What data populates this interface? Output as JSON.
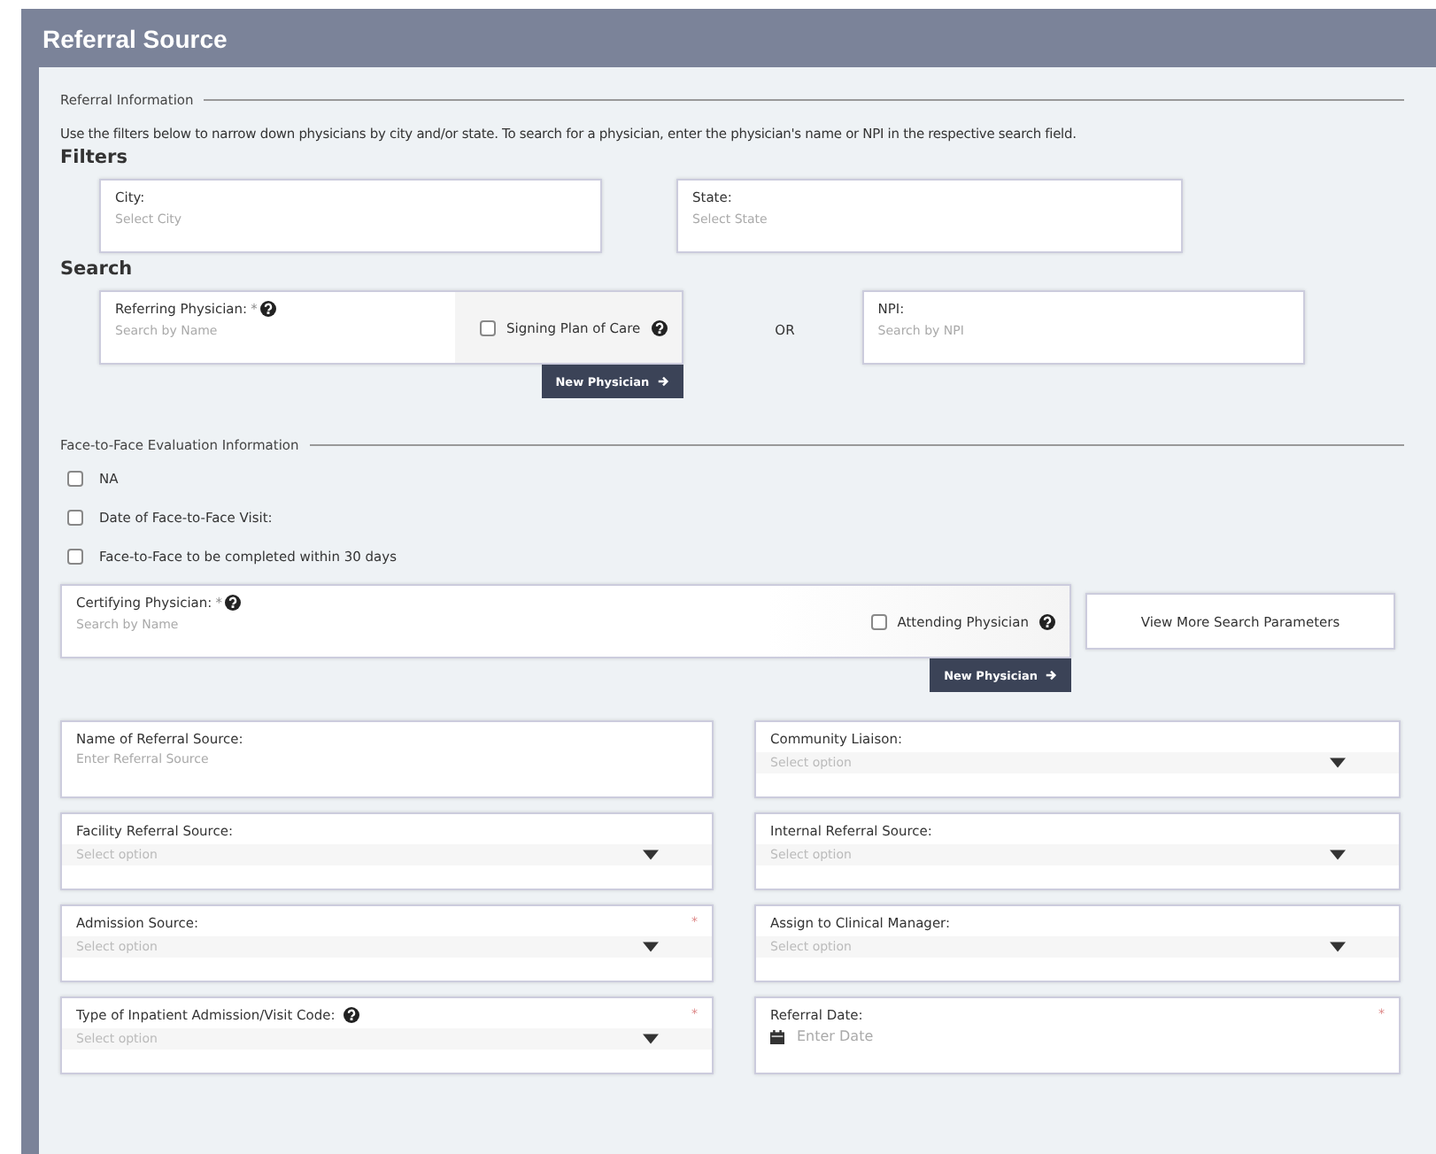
{
  "title": "Referral Source",
  "referral_information": {
    "legend": "Referral Information",
    "instructions": "Use the filters below to narrow down physicians by city and/or state. To search for a physician, enter the physician's name or NPI in the respective search field.",
    "filters": {
      "heading": "Filters",
      "city": {
        "label": "City:",
        "placeholder": "Select City"
      },
      "state": {
        "label": "State:",
        "placeholder": "Select State"
      }
    },
    "search": {
      "heading": "Search",
      "referring_physician": {
        "label": "Referring Physician:",
        "required_mark": "*",
        "placeholder": "Search by Name"
      },
      "signing_plan_of_care": {
        "label": "Signing Plan of Care",
        "checked": false
      },
      "new_physician_button": "New Physician",
      "or_label": "OR",
      "npi": {
        "label": "NPI:",
        "placeholder": "Search by NPI"
      }
    }
  },
  "face_to_face": {
    "legend": "Face-to-Face Evaluation Information",
    "options": [
      {
        "label": "NA",
        "checked": false
      },
      {
        "label": "Date of Face-to-Face Visit:",
        "checked": false
      },
      {
        "label": "Face-to-Face to be completed within 30 days",
        "checked": false
      }
    ],
    "certifying_physician": {
      "label": "Certifying Physician:",
      "required_mark": "*",
      "placeholder": "Search by Name"
    },
    "attending_physician": {
      "label": "Attending Physician",
      "checked": false
    },
    "view_more_button": "View More Search Parameters",
    "new_physician_button": "New Physician"
  },
  "fields": [
    {
      "kind": "text",
      "label": "Name of Referral Source:",
      "placeholder": "Enter Referral Source",
      "help": false
    },
    {
      "kind": "select",
      "label": "Community Liaison:",
      "placeholder": "Select option",
      "help": false
    },
    {
      "kind": "select",
      "label": "Facility Referral Source:",
      "placeholder": "Select option",
      "help": false
    },
    {
      "kind": "select",
      "label": "Internal Referral Source:",
      "placeholder": "Select option",
      "help": false
    },
    {
      "kind": "select",
      "label": "Admission Source:",
      "placeholder": "Select option",
      "required_mark": "*",
      "help": false
    },
    {
      "kind": "select",
      "label": "Assign to Clinical Manager:",
      "placeholder": "Select option",
      "help": false
    },
    {
      "kind": "select",
      "label": "Type of Inpatient Admission/Visit Code:",
      "placeholder": "Select option",
      "required_mark": "*",
      "help": true
    },
    {
      "kind": "date",
      "label": "Referral Date:",
      "placeholder": "Enter Date",
      "required_mark": "*",
      "help": false
    }
  ]
}
